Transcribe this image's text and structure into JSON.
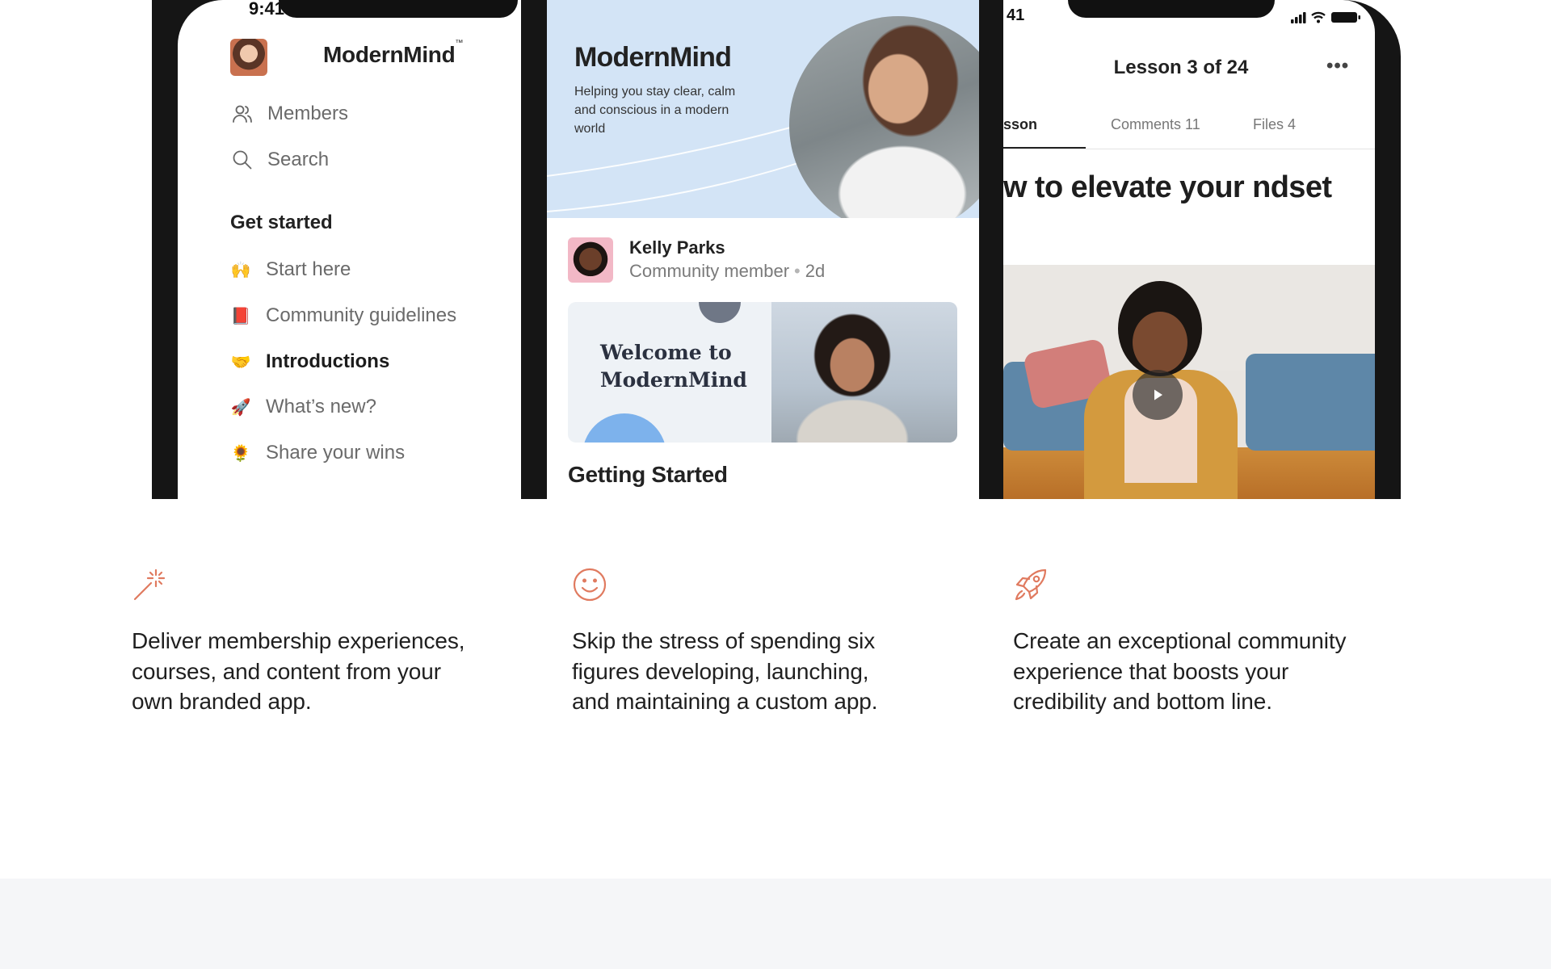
{
  "phone_left": {
    "status_time": "9:41",
    "brand": "ModernMind",
    "brand_mark": "™",
    "nav": [
      {
        "icon": "members-icon",
        "label": "Members"
      },
      {
        "icon": "search-icon",
        "label": "Search"
      }
    ],
    "section_title": "Get started",
    "menu": [
      {
        "emoji": "🙌",
        "label": "Start here"
      },
      {
        "emoji": "📕",
        "label": "Community guidelines"
      },
      {
        "emoji": "🤝",
        "label": "Introductions",
        "active": true
      },
      {
        "emoji": "🚀",
        "label": "What’s new?"
      },
      {
        "emoji": "🌻",
        "label": "Share your wins"
      }
    ]
  },
  "phone_center": {
    "hero_title": "ModernMind",
    "hero_subtitle": "Helping you stay clear, calm and conscious in a modern world",
    "post": {
      "author": "Kelly Parks",
      "role": "Community member",
      "separator": "•",
      "age": "2d"
    },
    "welcome_card_text": "Welcome to ModernMind",
    "section_title": "Getting Started"
  },
  "phone_right": {
    "status_time": "41",
    "lesson_counter": "Lesson 3 of 24",
    "more_label": "•••",
    "tabs": [
      {
        "label": "sson",
        "active": true
      },
      {
        "label": "Comments 11"
      },
      {
        "label": "Files 4"
      }
    ],
    "lesson_heading": "w to elevate your ndset"
  },
  "features": [
    {
      "icon": "magic-wand-icon",
      "text": "Deliver membership experiences, courses, and content from your own branded app."
    },
    {
      "icon": "smiley-face-icon",
      "text": "Skip the stress of spending six figures developing, launching, and maintaining a custom app."
    },
    {
      "icon": "rocket-icon",
      "text": "Create an exceptional community experience that boosts your credibility and bottom line."
    }
  ],
  "colors": {
    "accent": "#e07a5f",
    "hero_background": "#d3e4f6",
    "bottom_band": "#f5f6f8"
  }
}
